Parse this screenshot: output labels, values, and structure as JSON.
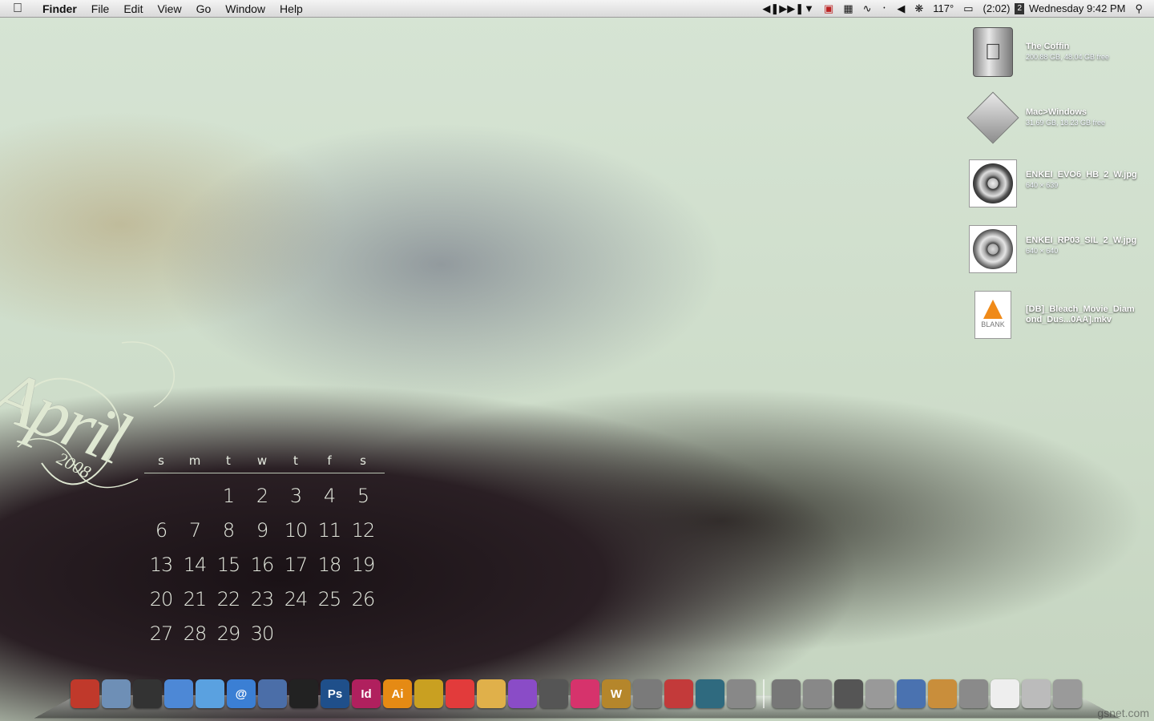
{
  "menubar": {
    "app": "Finder",
    "menus": [
      "File",
      "Edit",
      "View",
      "Go",
      "Window",
      "Help"
    ],
    "status": {
      "temp": "117°",
      "battery": "(2:02)",
      "datetime": "Wednesday 9:42 PM",
      "space_number": "2"
    },
    "icons": [
      "apple-icon",
      "media-controls-icon",
      "wifi-icon",
      "bluetooth-icon",
      "volume-icon",
      "fan-icon",
      "battery-icon",
      "spotlight-icon"
    ]
  },
  "desktop": {
    "items": [
      {
        "name": "The Coffin",
        "info": "200.88 GB, 48.04 GB free",
        "type": "hdd"
      },
      {
        "name": "Mac>Windows",
        "info": "31.69 GB, 18.23 GB free",
        "type": "windows-volume"
      },
      {
        "name": "ENKEI_EVO6_HB_2_W.jpg",
        "info": "640 × 639",
        "type": "image"
      },
      {
        "name": "ENKEI_RP03_SIL_2_W.jpg",
        "info": "640 × 640",
        "type": "image"
      },
      {
        "name": "[DB]_Bleach_Movie_Diamond_Dus...0AA].mkv",
        "info": "",
        "type": "video"
      }
    ]
  },
  "calendar": {
    "month": "April",
    "year": "2008",
    "weekdays": [
      "s",
      "m",
      "t",
      "w",
      "t",
      "f",
      "s"
    ],
    "days": [
      "",
      "",
      "1",
      "2",
      "3",
      "4",
      "5",
      "6",
      "7",
      "8",
      "9",
      "10",
      "11",
      "12",
      "13",
      "14",
      "15",
      "16",
      "17",
      "18",
      "19",
      "20",
      "21",
      "22",
      "23",
      "24",
      "25",
      "26",
      "27",
      "28",
      "29",
      "30",
      "",
      "",
      ""
    ]
  },
  "dock": {
    "apps": [
      {
        "name": "finder",
        "label": "",
        "color": "#c0392b"
      },
      {
        "name": "preview",
        "label": "",
        "color": "#6e8fb6"
      },
      {
        "name": "camera",
        "label": "",
        "color": "#333333"
      },
      {
        "name": "safari",
        "label": "",
        "color": "#4d88d6"
      },
      {
        "name": "itunes",
        "label": "",
        "color": "#5aa1e0"
      },
      {
        "name": "mail",
        "label": "@",
        "color": "#3b7fd4"
      },
      {
        "name": "iphoto",
        "label": "",
        "color": "#4b6ea8"
      },
      {
        "name": "aperture",
        "label": "",
        "color": "#222222"
      },
      {
        "name": "photoshop",
        "label": "Ps",
        "color": "#1f4f8a"
      },
      {
        "name": "indesign",
        "label": "Id",
        "color": "#b0205e"
      },
      {
        "name": "illustrator",
        "label": "Ai",
        "color": "#e58a14"
      },
      {
        "name": "cyberduck",
        "label": "",
        "color": "#c9a021"
      },
      {
        "name": "calendar",
        "label": "",
        "color": "#e23b3b"
      },
      {
        "name": "toaster",
        "label": "",
        "color": "#e0b04a"
      },
      {
        "name": "orb",
        "label": "",
        "color": "#8a4cc7"
      },
      {
        "name": "trash-folder",
        "label": "",
        "color": "#555555"
      },
      {
        "name": "media",
        "label": "",
        "color": "#d6336c"
      },
      {
        "name": "warcraft",
        "label": "W",
        "color": "#b5862b"
      },
      {
        "name": "vmware",
        "label": "",
        "color": "#7a7a7a"
      },
      {
        "name": "parallels",
        "label": "",
        "color": "#c33a3a"
      },
      {
        "name": "time-machine",
        "label": "",
        "color": "#2f6a7f"
      },
      {
        "name": "system-preferences",
        "label": "",
        "color": "#888888"
      }
    ],
    "stacks": [
      {
        "name": "applications-stack",
        "color": "#777777"
      },
      {
        "name": "documents-stack",
        "color": "#888888"
      },
      {
        "name": "iphone-stack",
        "color": "#555555"
      },
      {
        "name": "downloads-stack",
        "color": "#999999"
      },
      {
        "name": "network-stack",
        "color": "#4a72b0"
      },
      {
        "name": "picture-stack",
        "color": "#c98e3b"
      },
      {
        "name": "printer-stack",
        "color": "#8a8a8a"
      },
      {
        "name": "text-stack",
        "color": "#eeeeee"
      },
      {
        "name": "web-stack",
        "color": "#bbbbbb"
      },
      {
        "name": "trash",
        "color": "#9a9a9a"
      }
    ]
  },
  "watermark": "gsnet.com"
}
